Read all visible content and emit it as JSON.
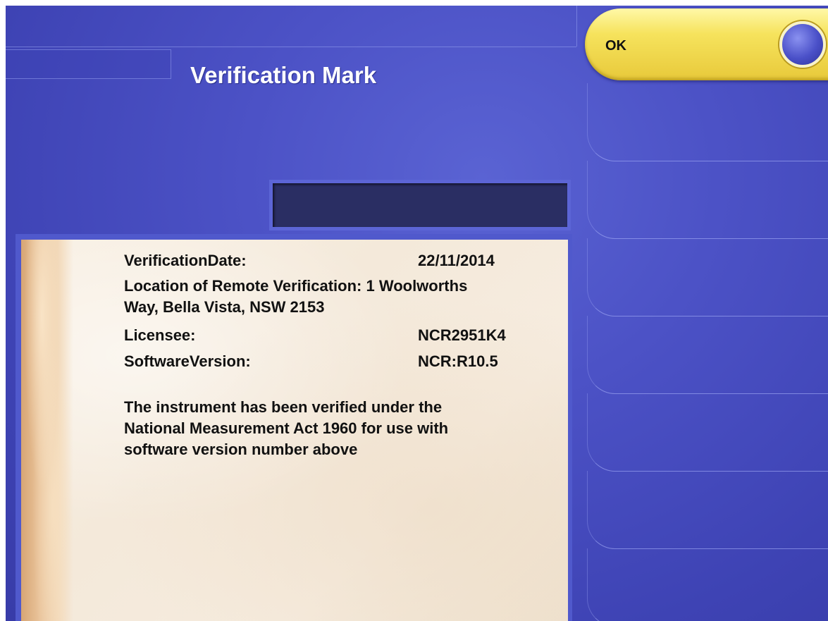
{
  "header": {
    "title": "Verification Mark"
  },
  "actions": {
    "ok_label": "OK"
  },
  "verification": {
    "date_label": "VerificationDate:",
    "date_value": "22/11/2014",
    "location_line1": "Location of Remote Verification: 1 Woolworths",
    "location_line2": "Way, Bella Vista, NSW 2153",
    "licensee_label": "Licensee:",
    "licensee_value": "NCR2951K4",
    "software_label": "SoftwareVersion:",
    "software_value": "NCR:R10.5",
    "statement_line1": "The instrument has been verified under the",
    "statement_line2": "National Measurement Act 1960 for use with",
    "statement_line3": "software version number above"
  },
  "colors": {
    "background": "#4c52c6",
    "button": "#f6e35d",
    "panel": "#f6ecdf"
  }
}
